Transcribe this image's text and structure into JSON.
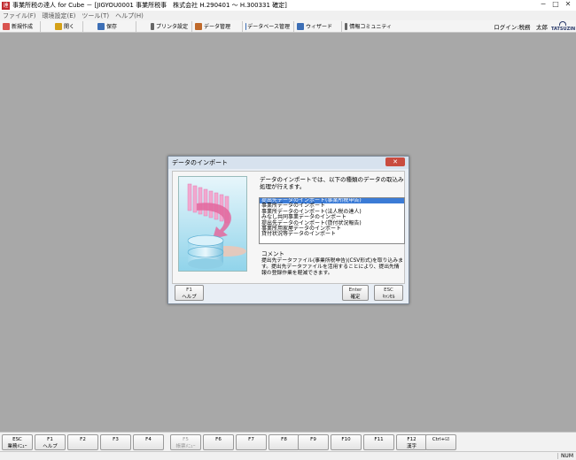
{
  "window": {
    "title": "事業所税の達人 for Cube － [JIGYOU0001 事業所税事　株式会社 H.290401 ～ H.300331 確定]",
    "controls": [
      "─",
      "□",
      "✕"
    ]
  },
  "menu": [
    "ファイル(F)",
    "環境設定(E)",
    "ツール(T)",
    "ヘルプ(H)"
  ],
  "toolbar": {
    "buttons": [
      {
        "label": "新規作成",
        "icon": "new-file-icon",
        "color": "#d9534f"
      },
      {
        "label": "開く",
        "icon": "open-folder-icon",
        "color": "#d4a017"
      },
      {
        "label": "保存",
        "icon": "save-icon",
        "color": "#3d6fb6"
      },
      {
        "label": "プリンタ設定",
        "icon": "printer-icon",
        "color": "#555555"
      },
      {
        "label": "データ管理",
        "icon": "data-management-icon",
        "color": "#c06a2b"
      },
      {
        "label": "データベース管理",
        "icon": "database-icon",
        "color": "#3d6fb6"
      },
      {
        "label": "ウィザード",
        "icon": "wizard-icon",
        "color": "#3d6fb6"
      },
      {
        "label": "情報コミュニティ",
        "icon": "community-icon",
        "color": "#555555"
      }
    ],
    "login": "ログイン:税務　太郎",
    "logo": "TATSUZIN"
  },
  "dialog": {
    "title": "データのインポート",
    "close": "✕",
    "description": "データのインポートでは、以下の種類のデータの取込み処理が行えます。",
    "items": [
      "提出先データのインポート(事業所税申告)",
      "事業所データのインポート",
      "事業所データのインポート(法人税の達人)",
      "みなし共同事業データのインポート",
      "提出先データのインポート(貸付状況報告)",
      "事業所用家屋データのインポート",
      "貸付状況等データのインポート"
    ],
    "selected_index": 0,
    "comment_label": "コメント",
    "comment": "提出先データファイル(事業所税申告)(CSV形式)を取り込みます。提出先データファイルを活用することにより、提出先情報の登録作業を軽減できます。",
    "buttons": {
      "help": {
        "key": "F1",
        "label": "ヘルプ"
      },
      "ok": {
        "key": "Enter",
        "label": "確定"
      },
      "cancel": {
        "key": "ESC",
        "label": "ｷｬﾝｾﾙ"
      }
    }
  },
  "fkeys": [
    {
      "key": "ESC",
      "label": "業務ﾒﾆｭｰ",
      "enabled": true
    },
    {
      "key": "F1",
      "label": "ヘルプ",
      "enabled": true
    },
    {
      "key": "F2",
      "label": "",
      "enabled": true
    },
    {
      "key": "F3",
      "label": "",
      "enabled": true
    },
    {
      "key": "F4",
      "label": "",
      "enabled": true
    },
    {
      "key": "F5",
      "label": "帳票ﾒﾆｭｰ",
      "enabled": false
    },
    {
      "key": "F6",
      "label": "",
      "enabled": true
    },
    {
      "key": "F7",
      "label": "",
      "enabled": true
    },
    {
      "key": "F8",
      "label": "",
      "enabled": true
    },
    {
      "key": "F9",
      "label": "",
      "enabled": true
    },
    {
      "key": "F10",
      "label": "",
      "enabled": true
    },
    {
      "key": "F11",
      "label": "",
      "enabled": true
    },
    {
      "key": "F12",
      "label": "漢字",
      "enabled": true
    },
    {
      "key": "Ctrl+☑",
      "label": "",
      "enabled": true
    }
  ],
  "status": {
    "num": "NUM"
  }
}
